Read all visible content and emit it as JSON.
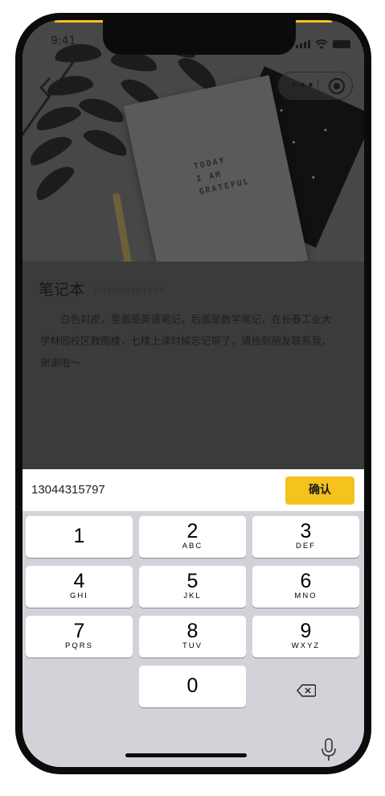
{
  "status_bar": {
    "time": "9:41"
  },
  "note": {
    "title": "笔记本",
    "date": "2019年4月2日13:24",
    "description": "白色封皮，里面是英语笔记，后面是数学笔记，在长春工业大学林园校区教图楼，七楼上课时候忘记带了，请拾到朋友联系我，谢谢啦～"
  },
  "photo": {
    "notebook_text": [
      "TODAY",
      "I AM",
      "GRATEFUL"
    ]
  },
  "input": {
    "value": "13044315797",
    "confirm_label": "确认"
  },
  "keypad": {
    "keys": [
      {
        "number": "1",
        "letters": ""
      },
      {
        "number": "2",
        "letters": "ABC"
      },
      {
        "number": "3",
        "letters": "DEF"
      },
      {
        "number": "4",
        "letters": "GHI"
      },
      {
        "number": "5",
        "letters": "JKL"
      },
      {
        "number": "6",
        "letters": "MNO"
      },
      {
        "number": "7",
        "letters": "PQRS"
      },
      {
        "number": "8",
        "letters": "TUV"
      },
      {
        "number": "9",
        "letters": "WXYZ"
      },
      {
        "number": "0",
        "letters": ""
      }
    ],
    "delete_icon": "backspace-icon",
    "mic_icon": "microphone-icon"
  },
  "colors": {
    "accent": "#f6c21c",
    "keypad_bg": "#d1d3d9",
    "overlay": "#3b3b3b"
  }
}
